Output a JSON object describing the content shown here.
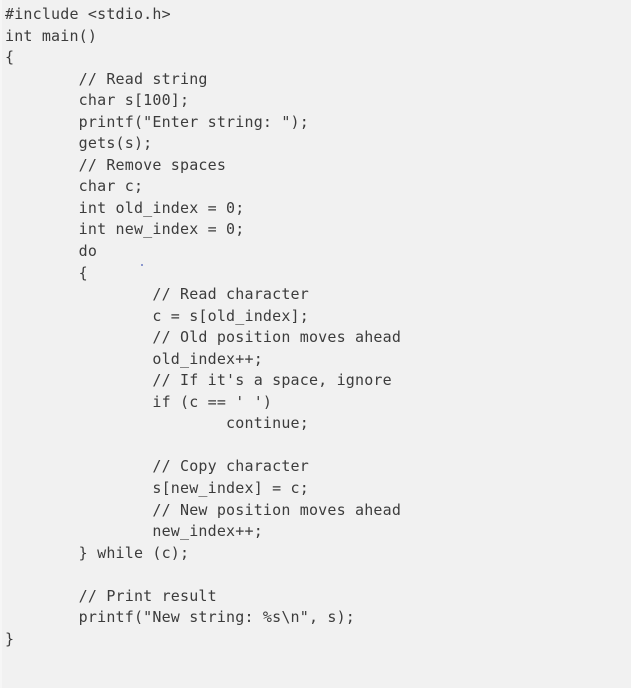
{
  "document": {
    "kind": "code-snippet",
    "language": "C",
    "background_color": "#f1f1f1",
    "text_color": "#3c3c3c",
    "artifact_dot_color": "#5566bb"
  },
  "code": {
    "lines": [
      "#include <stdio.h>",
      "int main()",
      "{",
      "        // Read string",
      "        char s[100];",
      "        printf(\"Enter string: \");",
      "        gets(s);",
      "        // Remove spaces",
      "        char c;",
      "        int old_index = 0;",
      "        int new_index = 0;",
      "        do ",
      "        {",
      "                // Read character",
      "                c = s[old_index];",
      "                // Old position moves ahead",
      "                old_index++;",
      "                // If it's a space, ignore",
      "                if (c == ' ')",
      "                        continue;",
      "",
      "                // Copy character",
      "                s[new_index] = c;",
      "                // New position moves ahead",
      "                new_index++;",
      "        } while (c);",
      "",
      "        // Print result",
      "        printf(\"New string: %s\\n\", s);",
      "}"
    ]
  }
}
